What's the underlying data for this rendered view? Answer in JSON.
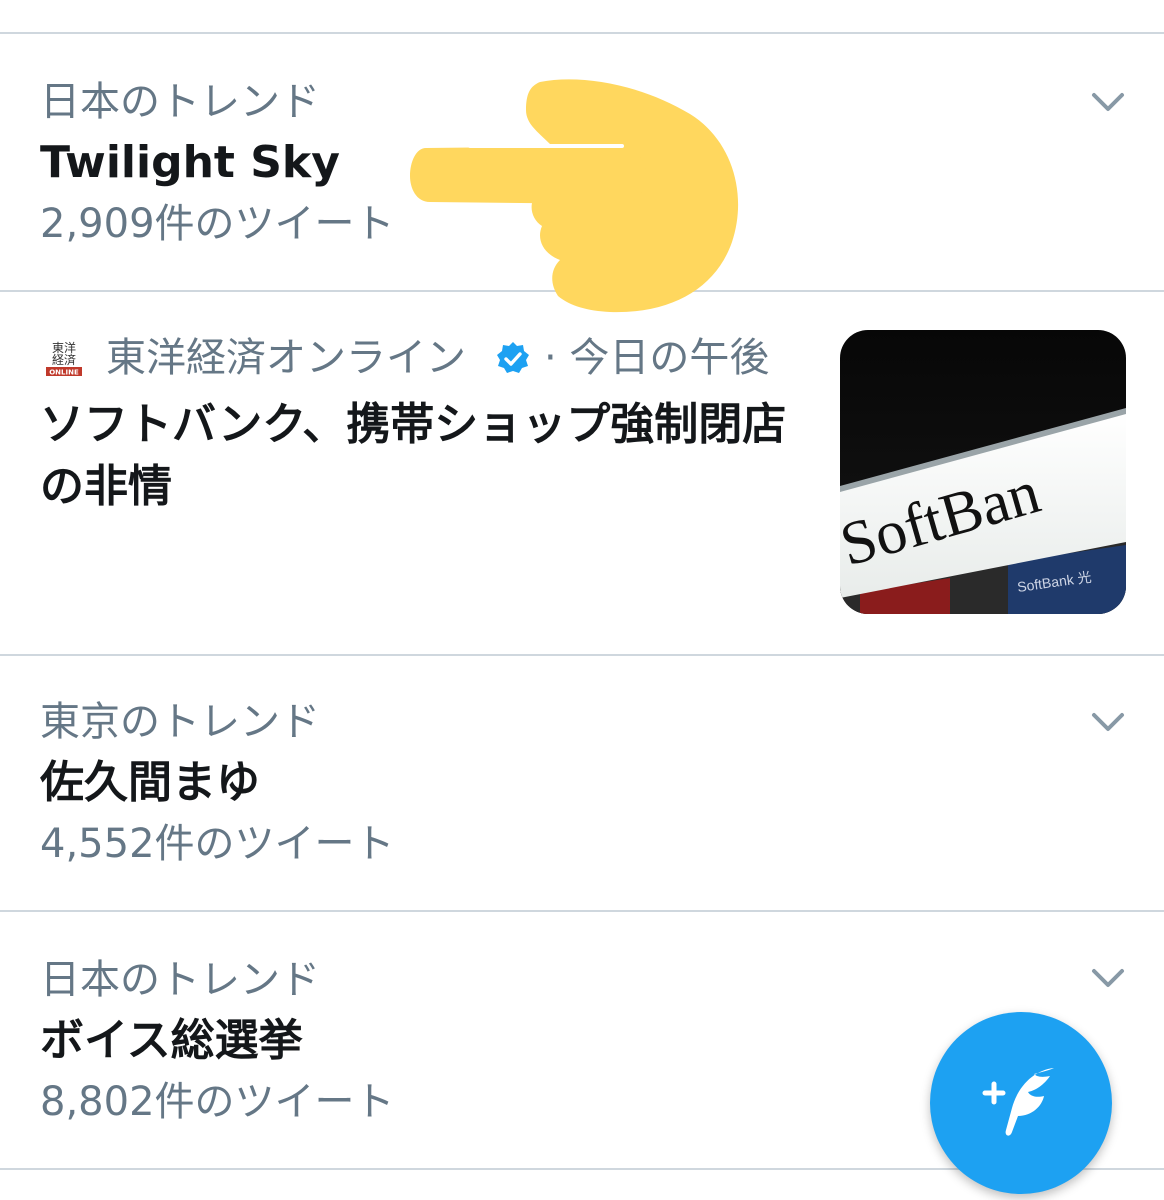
{
  "trends": [
    {
      "context": "日本のトレンド",
      "name": "Twilight Sky",
      "count": "2,909件のツイート"
    },
    {
      "context": "東京のトレンド",
      "name": "佐久間まゆ",
      "count": "4,552件のツイート"
    },
    {
      "context": "日本のトレンド",
      "name": "ボイス総選挙",
      "count": "8,802件のツイート"
    }
  ],
  "news": {
    "logo_text": "東洋経済ONLINE",
    "source": "東洋経済オンライン",
    "time": "· 今日の午後",
    "headline": "ソフトバンク、携帯ショップ強制閉店の非情",
    "thumbnail_sign_text": "SoftBan",
    "thumbnail_sub_text": "SoftBank 光"
  },
  "icons": {
    "chevron": "chevron-down-icon",
    "verified": "verified-badge-icon",
    "pointer": "pointing-hand-emoji",
    "compose": "compose-tweet-icon"
  },
  "colors": {
    "accent": "#1da1f2",
    "secondary_text": "#657786",
    "divider": "#cfd7de",
    "emoji": "#ffd75e"
  }
}
